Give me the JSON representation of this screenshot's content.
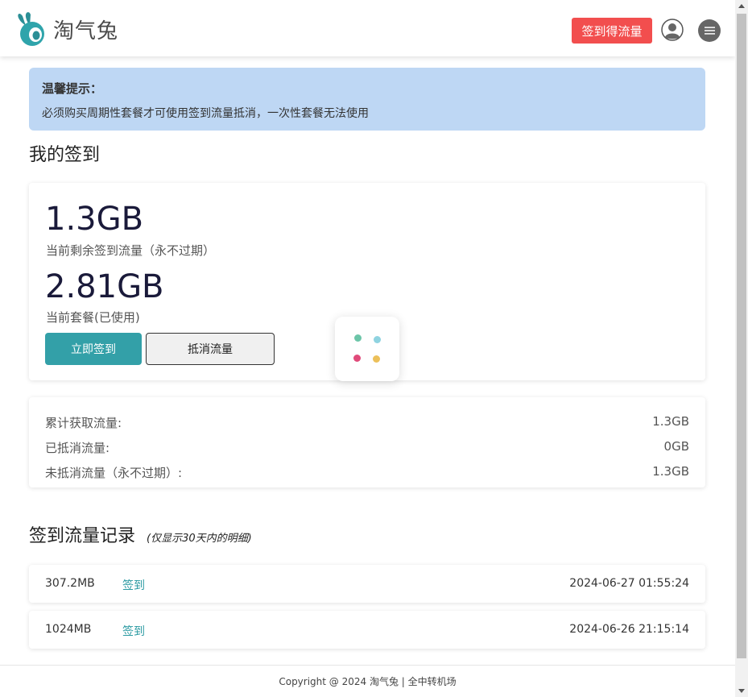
{
  "header": {
    "logo_text": "淘气兔",
    "signin_button": "签到得流量"
  },
  "notice": {
    "title": "温馨提示：",
    "text": "必须购买周期性套餐才可使用签到流量抵消，一次性套餐无法使用"
  },
  "my_signin": {
    "title": "我的签到",
    "remaining_value": "1.3GB",
    "remaining_label": "当前剩余签到流量（永不过期）",
    "used_value": "2.81GB",
    "used_label": "当前套餐(已使用)",
    "signin_now_button": "立即签到",
    "offset_button": "抵消流量"
  },
  "stats": [
    {
      "label": "累计获取流量:",
      "value": "1.3GB"
    },
    {
      "label": "已抵消流量:",
      "value": "0GB"
    },
    {
      "label": "未抵消流量（永不过期）:",
      "value": "1.3GB"
    }
  ],
  "records": {
    "title": "签到流量记录",
    "note": "(仅显示30天内的明细)",
    "items": [
      {
        "size": "307.2MB",
        "type": "签到",
        "time": "2024-06-27 01:55:24"
      },
      {
        "size": "1024MB",
        "type": "签到",
        "time": "2024-06-26 21:15:14"
      }
    ]
  },
  "footer": {
    "text": "Copyright @ 2024 淘气兔 | 全中转机场"
  },
  "colors": {
    "accent": "#33a0a8",
    "signin_red": "#f24e4e",
    "notice_bg": "#bed7f4",
    "loader_dots": [
      "#6cc5a8",
      "#8fd3e0",
      "#e04a7a",
      "#ecc05a"
    ]
  },
  "icons": {
    "logo": "rabbit-logo-icon",
    "avatar": "user-avatar-icon",
    "menu": "hamburger-menu-icon",
    "loader": "loading-dots-icon"
  }
}
